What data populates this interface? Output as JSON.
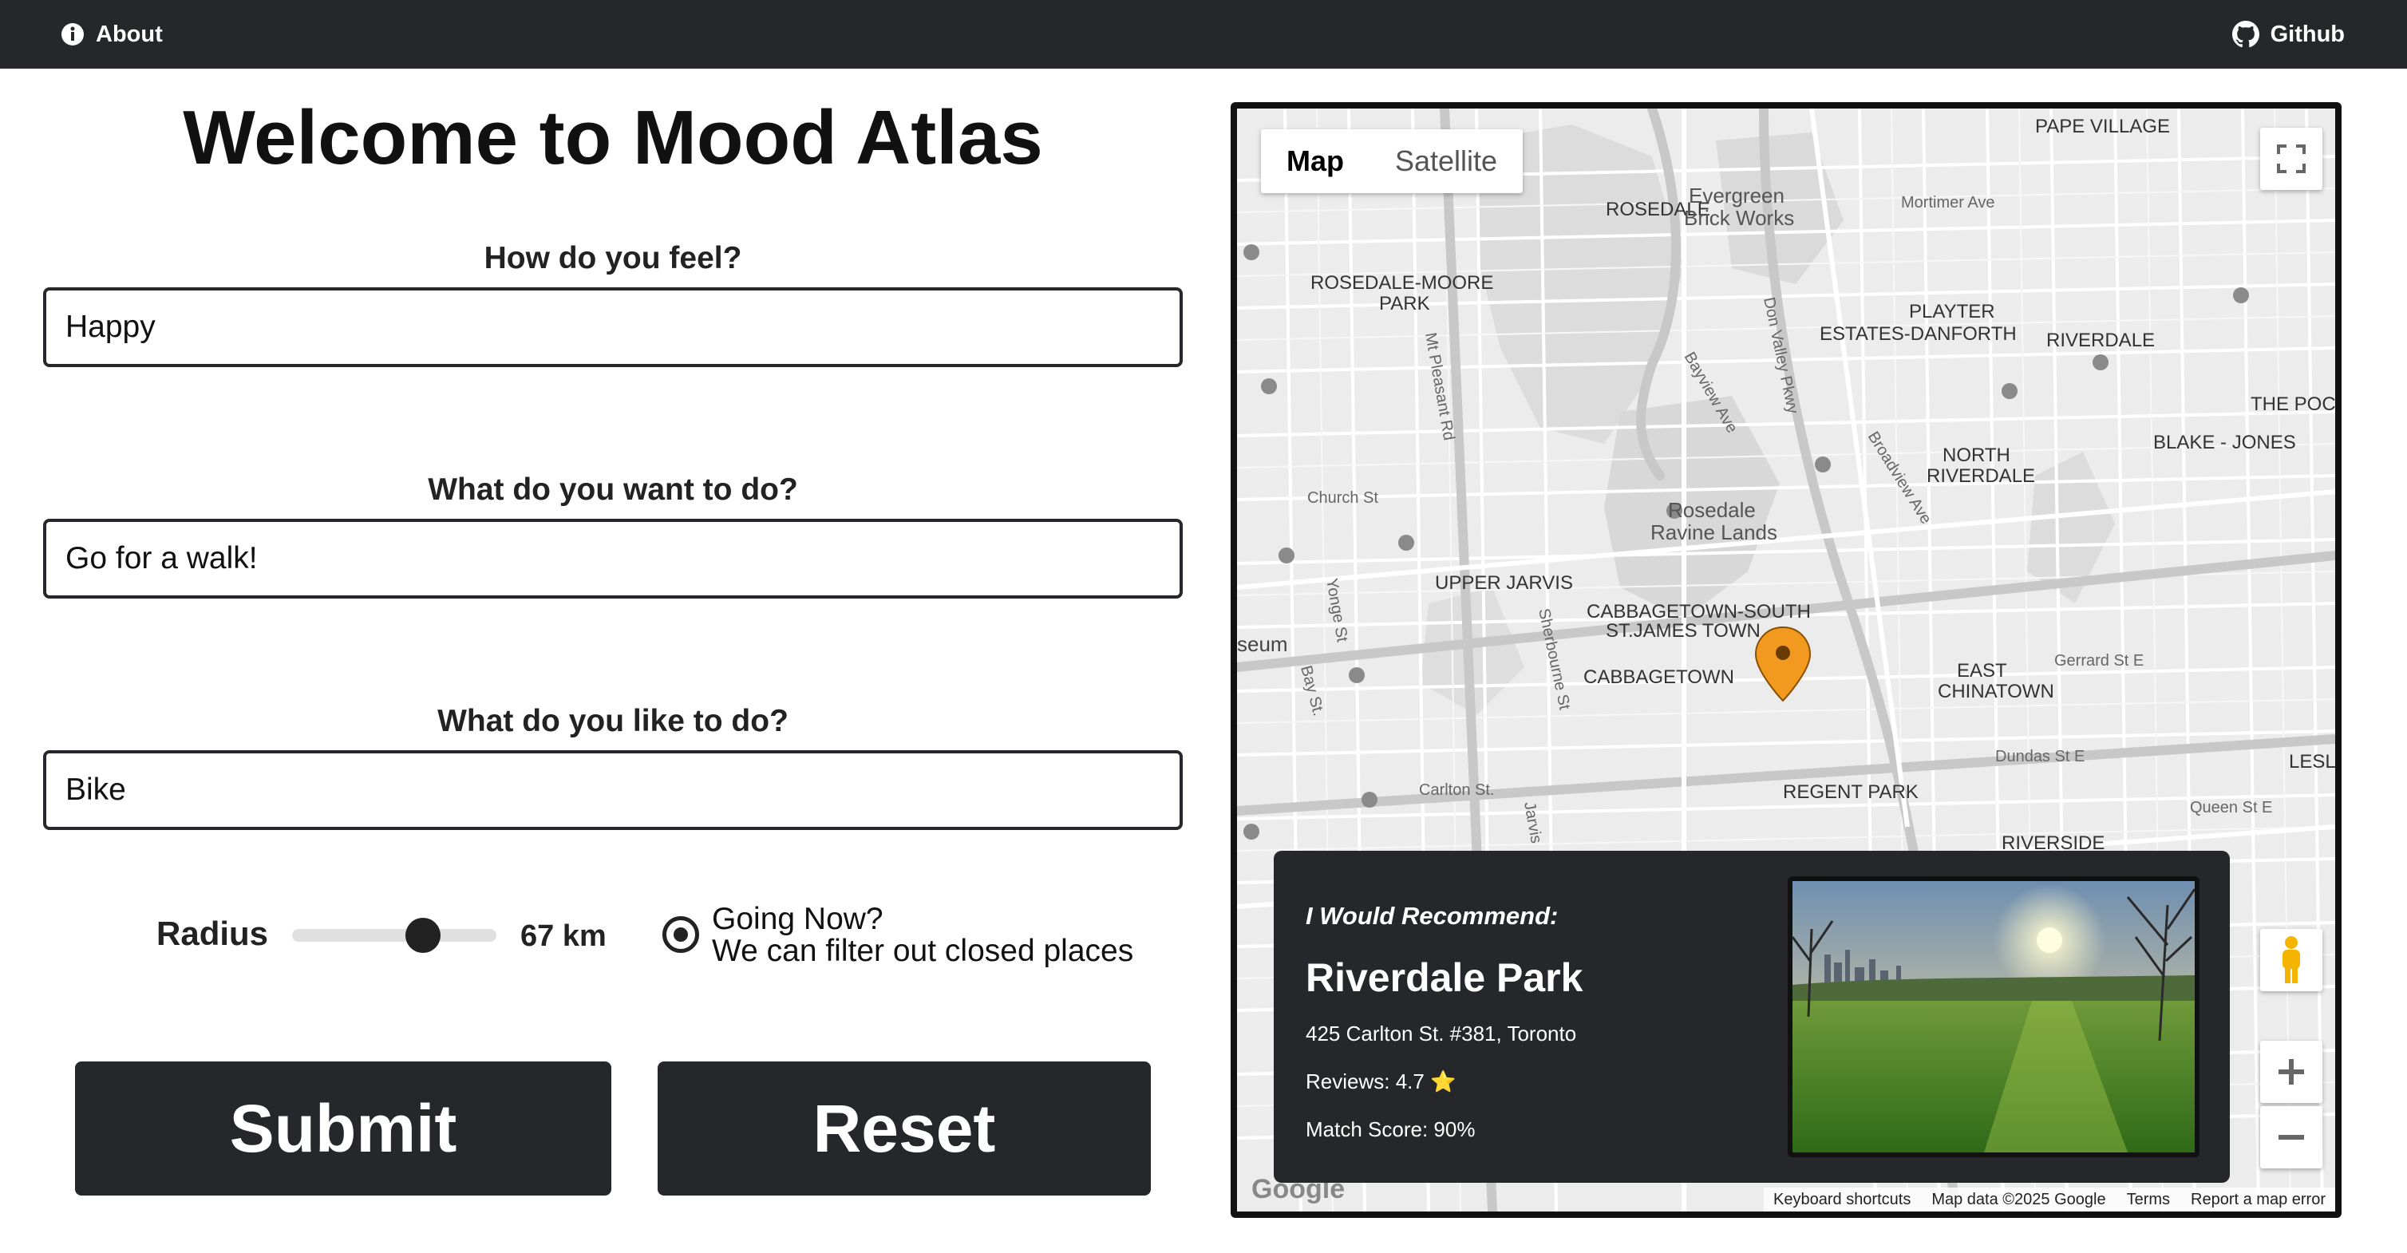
{
  "nav": {
    "about_label": "About",
    "github_label": "Github"
  },
  "title": "Welcome to Mood Atlas",
  "form": {
    "feel_label": "How do you feel?",
    "feel_value": "Happy",
    "want_label": "What do you want to do?",
    "want_value": "Go for a walk!",
    "like_label": "What do you like to do?",
    "like_value": "Bike",
    "radius_label": "Radius",
    "radius_value": "67 km",
    "radius_fraction": 0.64,
    "going_now_title": "Going Now?",
    "going_now_desc": "We can filter out closed places",
    "submit_label": "Submit",
    "reset_label": "Reset"
  },
  "map": {
    "type_map": "Map",
    "type_satellite": "Satellite",
    "footer": {
      "shortcuts": "Keyboard shortcuts",
      "data": "Map data ©2025 Google",
      "terms": "Terms",
      "report": "Report a map error"
    },
    "google_logo": "Google",
    "labels": {
      "pape_village": "PAPE VILLAGE",
      "rosedale": "ROSEDALE",
      "evergreen": "Evergreen",
      "brick_works": "Brick Works",
      "mortimer": "Mortimer Ave",
      "rosedale_moore": "ROSEDALE-MOORE",
      "park": "PARK",
      "playter": "PLAYTER",
      "estates_danforth": "ESTATES-DANFORTH",
      "riverdale": "RIVERDALE",
      "the_pocket": "THE POC",
      "blake_jones": "BLAKE - JONES",
      "north": "NORTH",
      "north_riverdale": "RIVERDALE",
      "rosedale_ravine": "Rosedale",
      "ravine_lands": "Ravine Lands",
      "church": "Church St",
      "upper_jarvis": "UPPER JARVIS",
      "cabbagetown_south": "CABBAGETOWN-SOUTH",
      "st_james": "ST.JAMES TOWN",
      "cabbagetown": "CABBAGETOWN",
      "east": "EAST",
      "chinatown": "CHINATOWN",
      "gerrard": "Gerrard St E",
      "dundas": "Dundas St E",
      "leslie": "LESLIE",
      "regent_park": "REGENT PARK",
      "queen": "Queen St E",
      "riverside": "RIVERSIDE",
      "carlton": "Carlton St.",
      "museum": "seum",
      "mt_pleasant": "Mt Pleasant Rd",
      "don_valley": "Don Valley Pkwy",
      "bayview": "Bayview Ave",
      "broadview": "Broadview Ave",
      "yonge": "Yonge St",
      "bay": "Bay St.",
      "sherbourne": "Sherbourne St",
      "jarvis": "Jarvis"
    }
  },
  "recommendation": {
    "heading": "I Would Recommend:",
    "name": "Riverdale Park",
    "address": "425 Carlton St. #381, Toronto",
    "reviews": "Reviews: 4.7 ⭐",
    "match": "Match Score: 90%"
  },
  "colors": {
    "dark": "#25272b",
    "marker": "#f29a1f"
  }
}
